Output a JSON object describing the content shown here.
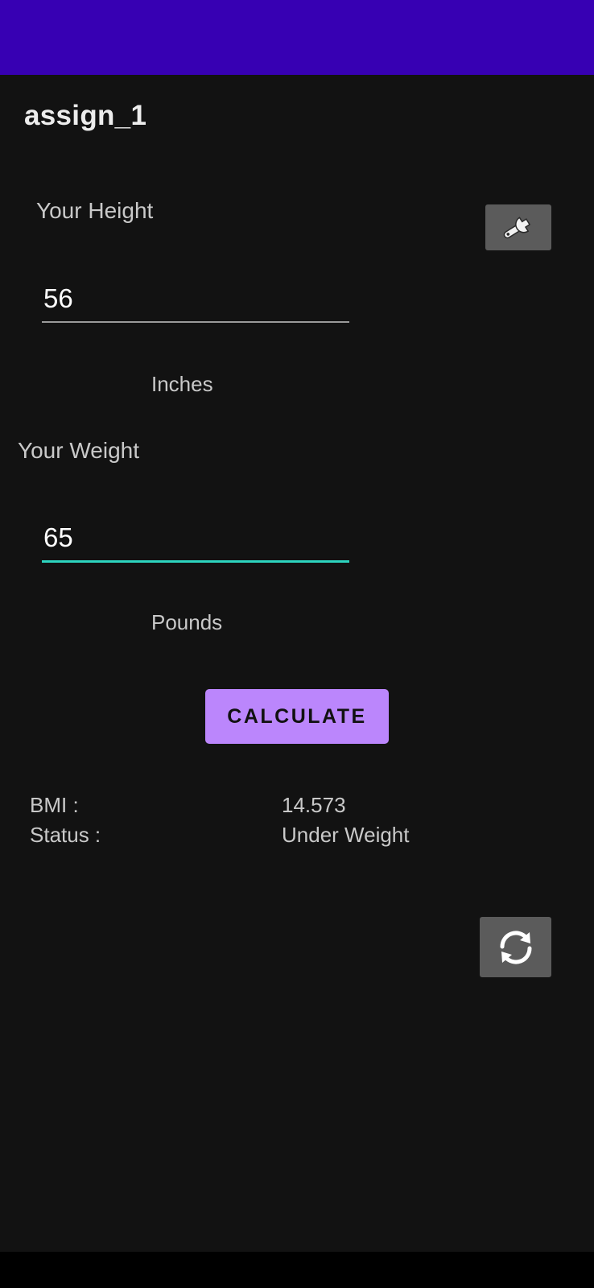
{
  "app": {
    "title": "assign_1"
  },
  "form": {
    "height_label": "Your Height",
    "height_value": "56",
    "height_unit": "Inches",
    "weight_label": "Your Weight",
    "weight_value": "65",
    "weight_unit": "Pounds",
    "calculate_label": "CALCULATE"
  },
  "results": {
    "bmi_label": "BMI :",
    "bmi_value": "14.573",
    "status_label": "Status :",
    "status_value": "Under Weight"
  },
  "icons": {
    "settings": "wrench-icon",
    "refresh": "refresh-icon"
  },
  "colors": {
    "status_bar": "#3700b3",
    "background": "#121212",
    "accent_button": "#bb86fc",
    "focused_underline": "#2dd4bf",
    "icon_button": "#5b5b5b"
  }
}
